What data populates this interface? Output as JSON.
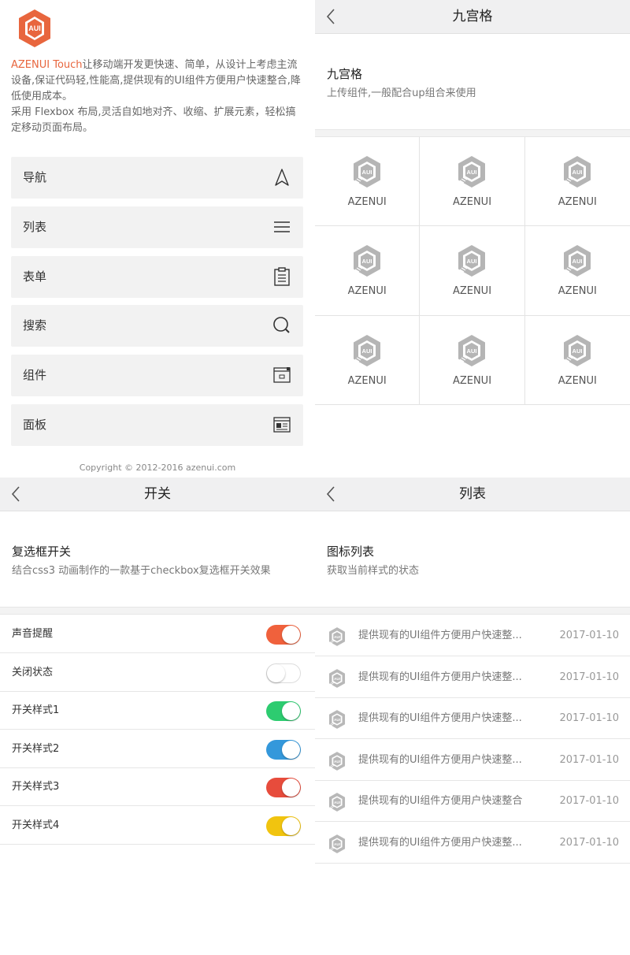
{
  "colors": {
    "brand": "#e8663e",
    "switch_default": "#f0613c",
    "switch_1": "#2dcc70",
    "switch_2": "#3498db",
    "switch_3": "#e74c3c",
    "switch_4": "#f1c40f"
  },
  "home": {
    "logo_text": "AUI",
    "intro_brand": "AZENUI Touch",
    "intro_rest": "让移动端开发更快速、简单，从设计上考虑主流设备,保证代码轻,性能高,提供现有的UI组件方便用户快速整合,降低使用成本。",
    "intro_line2": "采用 Flexbox 布局,灵活自如地对齐、收缩、扩展元素，轻松搞定移动页面布局。",
    "menu": [
      {
        "label": "导航",
        "icon": "navigation-icon"
      },
      {
        "label": "列表",
        "icon": "list-icon"
      },
      {
        "label": "表单",
        "icon": "form-icon"
      },
      {
        "label": "搜索",
        "icon": "search-icon"
      },
      {
        "label": "组件",
        "icon": "component-icon"
      },
      {
        "label": "面板",
        "icon": "panel-icon"
      }
    ],
    "copyright": "Copyright © 2012-2016 azenui.com"
  },
  "grid_page": {
    "nav_title": "九宫格",
    "section_title": "九宫格",
    "section_subtitle": "上传组件,一般配合up组合来使用",
    "cells": [
      "AZENUI",
      "AZENUI",
      "AZENUI",
      "AZENUI",
      "AZENUI",
      "AZENUI",
      "AZENUI",
      "AZENUI",
      "AZENUI"
    ],
    "cell_icon_text": "AUI"
  },
  "switch_page": {
    "nav_title": "开关",
    "section_title": "复选框开关",
    "section_subtitle": "结合css3 动画制作的一款基于checkbox复选框开关效果",
    "rows": [
      {
        "label": "声音提醒",
        "on": true
      },
      {
        "label": "关闭状态",
        "on": false
      },
      {
        "label": "开关样式1",
        "on": true
      },
      {
        "label": "开关样式2",
        "on": true
      },
      {
        "label": "开关样式3",
        "on": true
      },
      {
        "label": "开关样式4",
        "on": true
      }
    ]
  },
  "list_page": {
    "nav_title": "列表",
    "section_title": "图标列表",
    "section_subtitle": "获取当前样式的状态",
    "icon_text": "AUI",
    "rows": [
      {
        "text": "提供现有的UI组件方便用户快速整...",
        "date": "2017-01-10"
      },
      {
        "text": "提供现有的UI组件方便用户快速整...",
        "date": "2017-01-10"
      },
      {
        "text": "提供现有的UI组件方便用户快速整...",
        "date": "2017-01-10"
      },
      {
        "text": "提供现有的UI组件方便用户快速整...",
        "date": "2017-01-10"
      },
      {
        "text": "提供现有的UI组件方便用户快速整合",
        "date": "2017-01-10"
      },
      {
        "text": "提供现有的UI组件方便用户快速整...",
        "date": "2017-01-10"
      }
    ]
  }
}
